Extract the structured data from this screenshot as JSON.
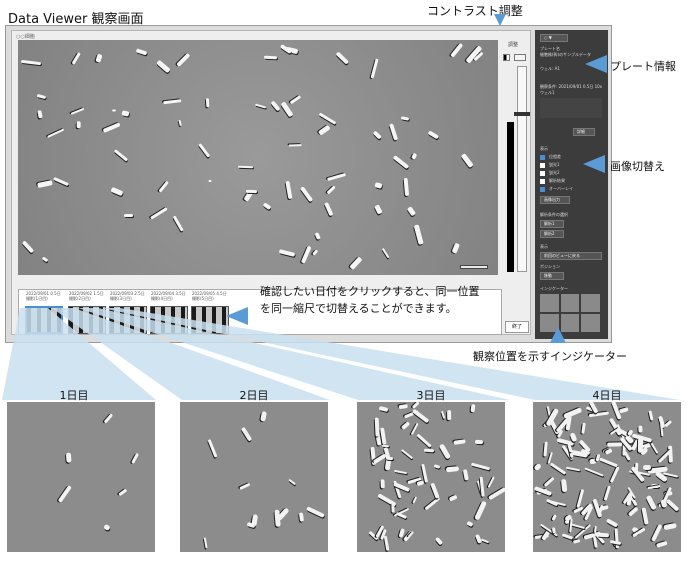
{
  "title": "Data Viewer 観察画面",
  "contrast_label": "コントラスト調整",
  "plate_info_label": "プレート情報",
  "image_switch_label": "画像切替え",
  "indicator_label": "観察位置を示すインジケーター",
  "description": "確認したい日付をクリックすると、同一位置を同一縮尺で切替えることができます。",
  "window": {
    "panel_tag": "○○細胞",
    "contrast_control_label": "調整",
    "end_button": "終了",
    "date_thumbs": [
      {
        "meta": "2022/09/01 0.5日 撮影(1日目)",
        "selected": true
      },
      {
        "meta": "2022/09/02 1.5日 撮影(2日目)",
        "selected": false
      },
      {
        "meta": "2022/09/03 2.5日 撮影(3日目)",
        "selected": false
      },
      {
        "meta": "2022/09/04 3.5日 撮影(4日目)",
        "selected": false
      },
      {
        "meta": "2022/09/05 4.5日 撮影(5日目)",
        "selected": false
      }
    ]
  },
  "side_panel": {
    "header": "○ ▼",
    "plate_lines": [
      "プレート名",
      "細胞株(幹)のサンプルデータ",
      "ウェル: A1",
      "観察条件: 2021/09/01 0.5日 10x",
      "ウェル1"
    ],
    "detail_button": "詳細",
    "display_title": "表示",
    "checks": [
      {
        "label": "位相差",
        "on": true
      },
      {
        "label": "蛍光1",
        "on": false
      },
      {
        "label": "蛍光2",
        "on": false
      },
      {
        "label": "解析結果",
        "on": false
      },
      {
        "label": "オーバーレイ",
        "on": true
      }
    ],
    "export_button": "画像出力",
    "analysis_title": "解析条件の選択",
    "analysis_buttons": [
      "解析1",
      "解析2"
    ],
    "view_title": "表示",
    "view_button": "前回のビューに戻る",
    "grid_title": "ポジション",
    "grid_button": "移動",
    "indicator_title": "インジケーター"
  },
  "days": [
    {
      "label": "1日目"
    },
    {
      "label": "2日目"
    },
    {
      "label": "3日目"
    },
    {
      "label": "4日目"
    }
  ],
  "colors": {
    "accent": "#5b9bd5",
    "panel_dark": "#3c3c3c",
    "microscope_gray": "#8e8e8e"
  }
}
